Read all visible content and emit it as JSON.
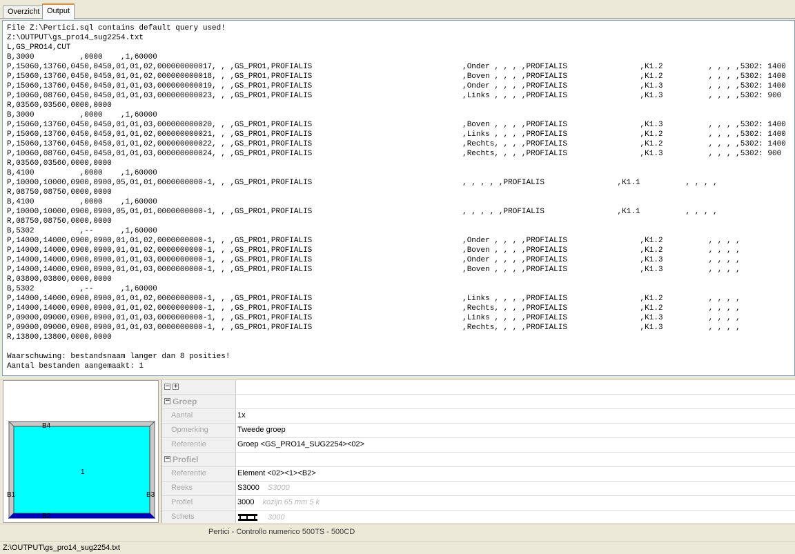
{
  "tabs": [
    {
      "label": "Overzicht",
      "active": false
    },
    {
      "label": "Output",
      "active": true
    }
  ],
  "output": {
    "lines": [
      "File Z:\\Pertici.sql contains default query used!",
      "Z:\\OUTPUT\\gs_pro14_sug2254.txt",
      "L,GS_PRO14,CUT",
      "B,3000          ,0000    ,1,60000",
      "P,15060,13760,0450,0450,01,01,02,000000000017, , ,GS_PRO1,PROFIALIS                                 ,Onder , , , ,PROFIALIS                ,K1.2          , , , ,5302: 1400",
      "P,15060,13760,0450,0450,01,01,02,000000000018, , ,GS_PRO1,PROFIALIS                                 ,Boven , , , ,PROFIALIS                ,K1.2          , , , ,5302: 1400",
      "P,15060,13760,0450,0450,01,01,03,000000000019, , ,GS_PRO1,PROFIALIS                                 ,Onder , , , ,PROFIALIS                ,K1.3          , , , ,5302: 1400",
      "P,10060,08760,0450,0450,01,01,03,000000000023, , ,GS_PRO1,PROFIALIS                                 ,Links , , , ,PROFIALIS                ,K1.3          , , , ,5302: 900",
      "R,03560,03560,0000,0000",
      "B,3000          ,0000    ,1,60000",
      "P,15060,13760,0450,0450,01,01,03,000000000020, , ,GS_PRO1,PROFIALIS                                 ,Boven , , , ,PROFIALIS                ,K1.3          , , , ,5302: 1400",
      "P,15060,13760,0450,0450,01,01,02,000000000021, , ,GS_PRO1,PROFIALIS                                 ,Links , , , ,PROFIALIS                ,K1.2          , , , ,5302: 1400",
      "P,15060,13760,0450,0450,01,01,02,000000000022, , ,GS_PRO1,PROFIALIS                                 ,Rechts, , , ,PROFIALIS                ,K1.2          , , , ,5302: 1400",
      "P,10060,08760,0450,0450,01,01,03,000000000024, , ,GS_PRO1,PROFIALIS                                 ,Rechts, , , ,PROFIALIS                ,K1.3          , , , ,5302: 900",
      "R,03560,03560,0000,0000",
      "B,4100          ,0000    ,1,60000",
      "P,10000,10000,0900,0900,05,01,01,0000000000-1, , ,GS_PRO1,PROFIALIS                                 , , , , ,PROFIALIS                ,K1.1          , , , ,",
      "R,08750,08750,0000,0000",
      "B,4100          ,0000    ,1,60000",
      "P,10000,10000,0900,0900,05,01,01,0000000000-1, , ,GS_PRO1,PROFIALIS                                 , , , , ,PROFIALIS                ,K1.1          , , , ,",
      "R,08750,08750,0000,0000",
      "B,5302          ,--      ,1,60000",
      "P,14000,14000,0900,0900,01,01,02,0000000000-1, , ,GS_PRO1,PROFIALIS                                 ,Onder , , , ,PROFIALIS                ,K1.2          , , , ,",
      "P,14000,14000,0900,0900,01,01,02,0000000000-1, , ,GS_PRO1,PROFIALIS                                 ,Boven , , , ,PROFIALIS                ,K1.2          , , , ,",
      "P,14000,14000,0900,0900,01,01,03,0000000000-1, , ,GS_PRO1,PROFIALIS                                 ,Onder , , , ,PROFIALIS                ,K1.3          , , , ,",
      "P,14000,14000,0900,0900,01,01,03,0000000000-1, , ,GS_PRO1,PROFIALIS                                 ,Boven , , , ,PROFIALIS                ,K1.3          , , , ,",
      "R,03800,03800,0000,0000",
      "B,5302          ,--      ,1,60000",
      "P,14000,14000,0900,0900,01,01,02,0000000000-1, , ,GS_PRO1,PROFIALIS                                 ,Links , , , ,PROFIALIS                ,K1.2          , , , ,",
      "P,14000,14000,0900,0900,01,01,02,0000000000-1, , ,GS_PRO1,PROFIALIS                                 ,Rechts, , , ,PROFIALIS                ,K1.2          , , , ,",
      "P,09000,09000,0900,0900,01,01,03,0000000000-1, , ,GS_PRO1,PROFIALIS                                 ,Links , , , ,PROFIALIS                ,K1.3          , , , ,",
      "P,09000,09000,0900,0900,01,01,03,0000000000-1, , ,GS_PRO1,PROFIALIS                                 ,Rechts, , , ,PROFIALIS                ,K1.3          , , , ,",
      "R,13800,13800,0000,0000",
      "",
      "Waarschuwing: bestandsnaam langer dan 8 posities!",
      "Aantal bestanden aangemaakt: 1"
    ]
  },
  "preview": {
    "panel_number": "1",
    "labels": {
      "top": "B4",
      "left": "B1",
      "right": "B3",
      "bottom": "B2"
    },
    "colors": {
      "fill": "#00ffff",
      "frame": "#c0c0c0",
      "accent": "#0000c0"
    }
  },
  "propgrid": {
    "toolbar": {
      "collapse_icon": "minus-box-icon",
      "expand_icon": "plus-box-icon"
    },
    "categories": [
      {
        "name": "Groep",
        "rows": [
          {
            "name": "Aantal",
            "value": "1x",
            "extra": ""
          },
          {
            "name": "Opmerking",
            "value": "Tweede groep",
            "extra": ""
          },
          {
            "name": "Referentie",
            "value": "Groep <GS_PRO14_SUG2254><02>",
            "extra": ""
          }
        ]
      },
      {
        "name": "Profiel",
        "rows": [
          {
            "name": "Referentie",
            "value": "Element <02><1><B2>",
            "extra": ""
          },
          {
            "name": "Reeks",
            "value": "S3000",
            "extra": "S3000"
          },
          {
            "name": "Profiel",
            "value": "3000",
            "extra": "kozijn 65 mm 5 k"
          },
          {
            "name": "Schets",
            "value": "",
            "extra": "3000"
          }
        ]
      }
    ]
  },
  "status": {
    "app_title": "Pertici - Controllo numerico 500TS - 500CD",
    "file_path": "Z:\\OUTPUT\\gs_pro14_sug2254.txt"
  }
}
